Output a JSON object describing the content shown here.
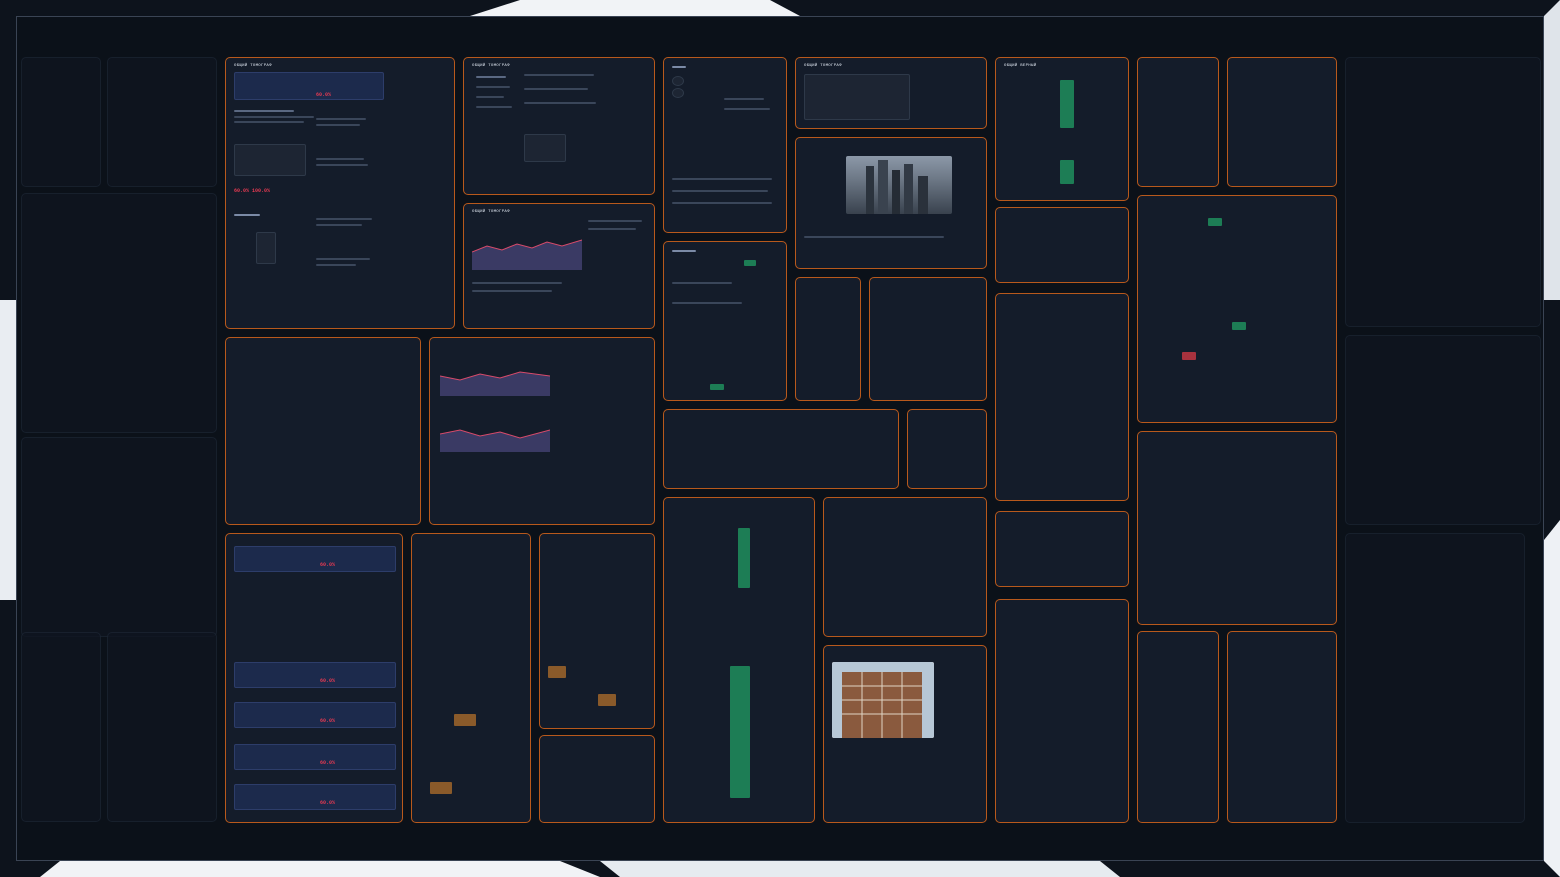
{
  "collage": {
    "description_visible_text": "",
    "panel_titles": {
      "main": "ОБЩИЙ ТОМОГРАФ",
      "cards": "ОБЩИЙ ТОМОГРАФ",
      "map": "ОБЩИЙ ТОМОГРАФ",
      "kits": "ОБЩИЙ ТОМОГРАФ",
      "fin": "ОБЩИЙ ВЕРНЫЙ"
    },
    "percentages": {
      "p1": "60.0%",
      "p2": "60.0% 100.0%",
      "p3": "60.0%",
      "p4": "60.0%",
      "p5": "60.0%",
      "p6": "60.0%",
      "p7": "60.0%"
    }
  },
  "colors": {
    "accent_border": "#b8591c",
    "panel_bg": "#141c2a",
    "card_blue": "#1c2a4c",
    "positive_green": "#1d7d55",
    "negative_red": "#e63a52",
    "canvas_bg": "#0b1119"
  }
}
